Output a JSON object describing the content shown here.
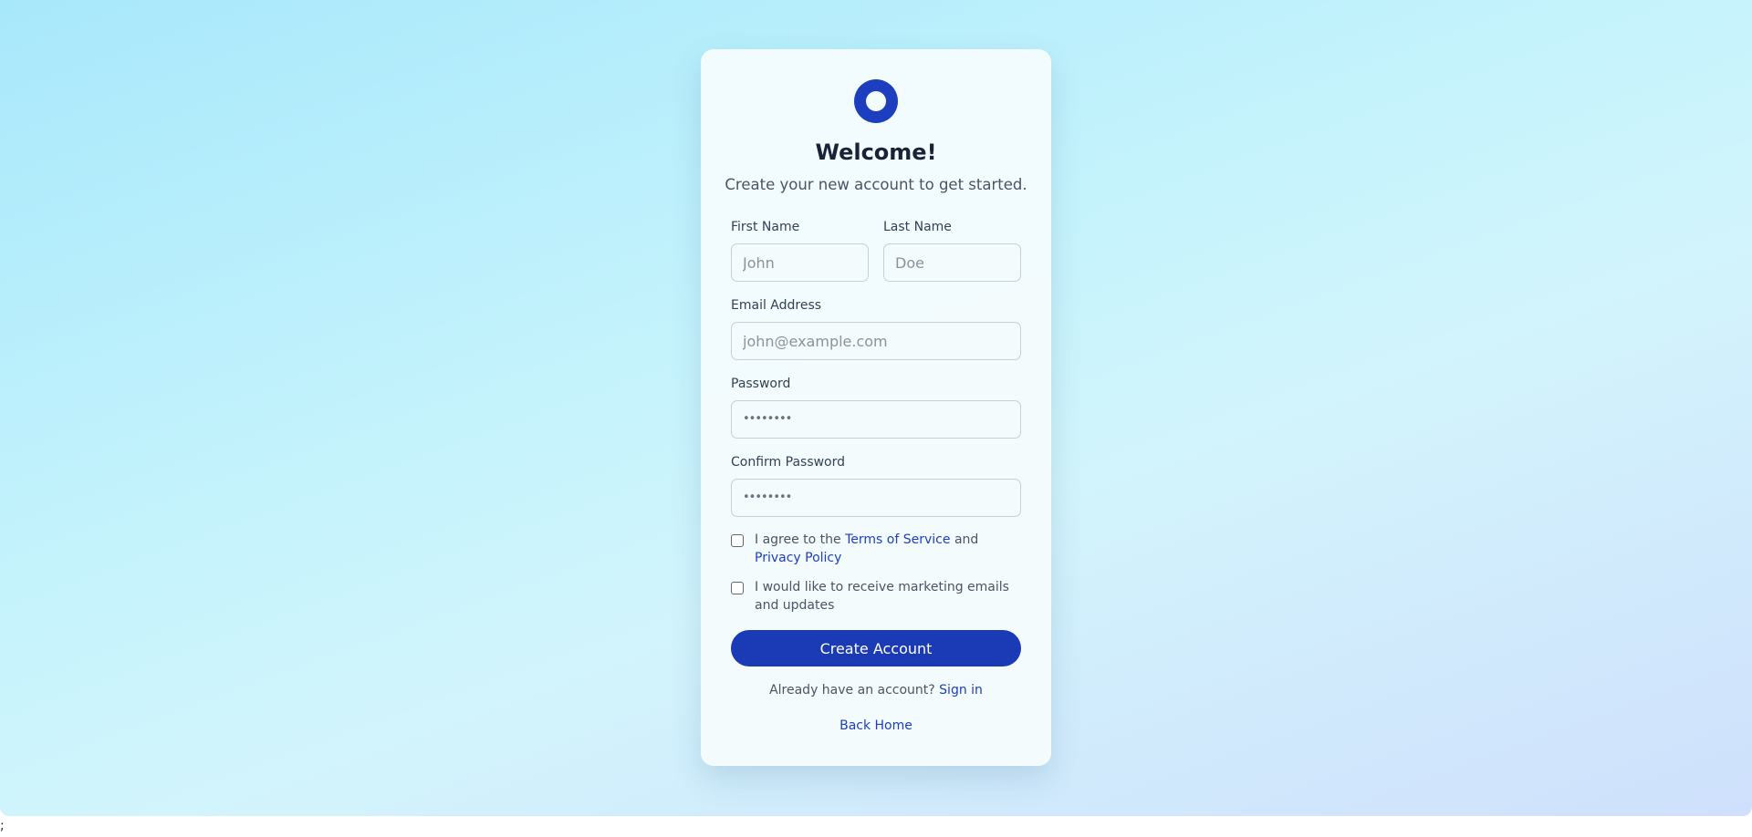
{
  "header": {
    "title": "Welcome!",
    "subtitle": "Create your new account to get started."
  },
  "form": {
    "first_name": {
      "label": "First Name",
      "placeholder": "John",
      "value": ""
    },
    "last_name": {
      "label": "Last Name",
      "placeholder": "Doe",
      "value": ""
    },
    "email": {
      "label": "Email Address",
      "placeholder": "john@example.com",
      "value": ""
    },
    "password": {
      "label": "Password",
      "masked_value": "••••••••"
    },
    "confirm_password": {
      "label": "Confirm Password",
      "masked_value": "••••••••"
    },
    "terms": {
      "prefix": "I agree to the",
      "terms_link": "Terms of Service",
      "and": "and",
      "privacy_link": "Privacy Policy",
      "checked": false
    },
    "marketing": {
      "label": "I would like to receive marketing emails and updates",
      "checked": false
    },
    "submit_label": "Create Account"
  },
  "footer": {
    "signin_prompt": "Already have an account?",
    "signin_link": "Sign in",
    "back_home": "Back Home"
  },
  "stray_text": ";",
  "icons": {
    "logo": "ring-logo-icon"
  },
  "colors": {
    "primary": "#1a3bb5",
    "link": "#1d3fbf",
    "background_start": "#a8e8fb",
    "background_end": "#cfe0fc",
    "card": "#f4fbfd"
  }
}
